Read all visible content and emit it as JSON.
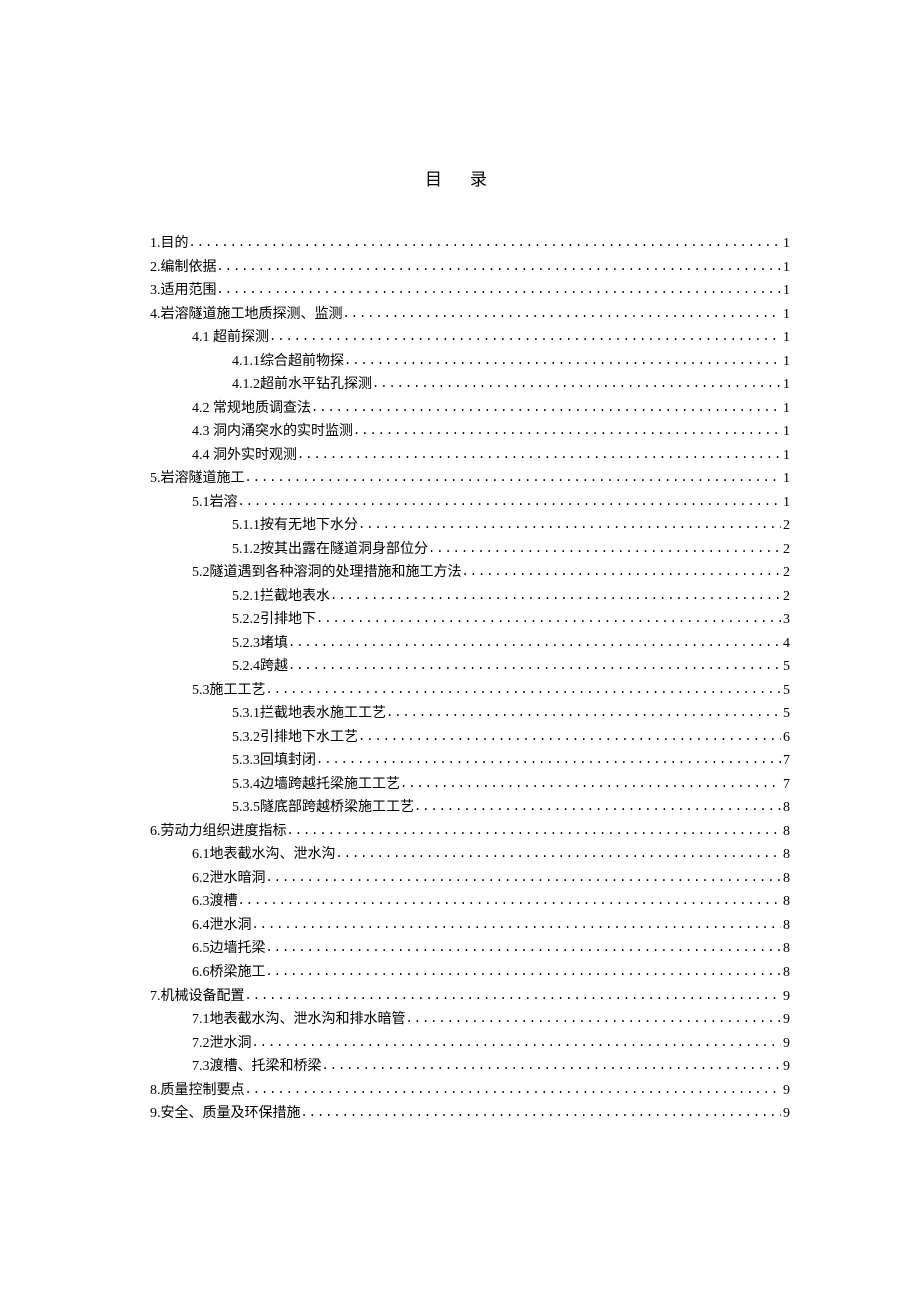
{
  "title": "目录",
  "dots": ".....................................................................................................................................................................................",
  "toc": [
    {
      "level": 0,
      "label": "1.目的",
      "page": "1"
    },
    {
      "level": 0,
      "label": "2.编制依据",
      "page": "1"
    },
    {
      "level": 0,
      "label": "3.适用范围",
      "page": "1"
    },
    {
      "level": 0,
      "label": "4.岩溶隧道施工地质探测、监测",
      "page": "1"
    },
    {
      "level": 1,
      "label": "4.1 超前探测",
      "page": "1"
    },
    {
      "level": 2,
      "label": "4.1.1综合超前物探",
      "page": "1"
    },
    {
      "level": 2,
      "label": "4.1.2超前水平钻孔探测",
      "page": "1"
    },
    {
      "level": 1,
      "label": "4.2 常规地质调查法",
      "page": "1"
    },
    {
      "level": 1,
      "label": "4.3 洞内涌突水的实时监测",
      "page": "1"
    },
    {
      "level": 1,
      "label": "4.4 洞外实时观测",
      "page": "1"
    },
    {
      "level": 0,
      "label": "5.岩溶隧道施工",
      "page": "1"
    },
    {
      "level": 1,
      "label": "5.1岩溶",
      "page": "1"
    },
    {
      "level": 2,
      "label": "5.1.1按有无地下水分",
      "page": "2"
    },
    {
      "level": 2,
      "label": "5.1.2按其出露在隧道洞身部位分",
      "page": "2"
    },
    {
      "level": 1,
      "label": "5.2隧道遇到各种溶洞的处理措施和施工方法",
      "page": "2"
    },
    {
      "level": 2,
      "label": "5.2.1拦截地表水",
      "page": "2"
    },
    {
      "level": 2,
      "label": "5.2.2引排地下",
      "page": "3"
    },
    {
      "level": 2,
      "label": "5.2.3堵填",
      "page": "4"
    },
    {
      "level": 2,
      "label": "5.2.4跨越",
      "page": "5"
    },
    {
      "level": 1,
      "label": "5.3施工工艺",
      "page": "5"
    },
    {
      "level": 2,
      "label": "5.3.1拦截地表水施工工艺",
      "page": "5"
    },
    {
      "level": 2,
      "label": "5.3.2引排地下水工艺",
      "page": "6"
    },
    {
      "level": 2,
      "label": "5.3.3回填封闭",
      "page": "7"
    },
    {
      "level": 2,
      "label": "5.3.4边墙跨越托梁施工工艺",
      "page": "7"
    },
    {
      "level": 2,
      "label": "5.3.5隧底部跨越桥梁施工工艺",
      "page": "8"
    },
    {
      "level": 0,
      "label": "6.劳动力组织进度指标",
      "page": "8"
    },
    {
      "level": 1,
      "label": "6.1地表截水沟、泄水沟",
      "page": "8"
    },
    {
      "level": 1,
      "label": "6.2泄水暗洞",
      "page": "8"
    },
    {
      "level": 1,
      "label": "6.3渡槽",
      "page": "8"
    },
    {
      "level": 1,
      "label": "6.4泄水洞",
      "page": "8"
    },
    {
      "level": 1,
      "label": "6.5边墙托梁",
      "page": "8"
    },
    {
      "level": 1,
      "label": "6.6桥梁施工",
      "page": "8"
    },
    {
      "level": 0,
      "label": "7.机械设备配置",
      "page": "9"
    },
    {
      "level": 1,
      "label": "7.1地表截水沟、泄水沟和排水暗管",
      "page": "9"
    },
    {
      "level": 1,
      "label": "7.2泄水洞",
      "page": "9"
    },
    {
      "level": 1,
      "label": "7.3渡槽、托梁和桥梁",
      "page": "9"
    },
    {
      "level": 0,
      "label": "8.质量控制要点",
      "page": "9"
    },
    {
      "level": 0,
      "label": "9.安全、质量及环保措施",
      "page": "9"
    }
  ]
}
